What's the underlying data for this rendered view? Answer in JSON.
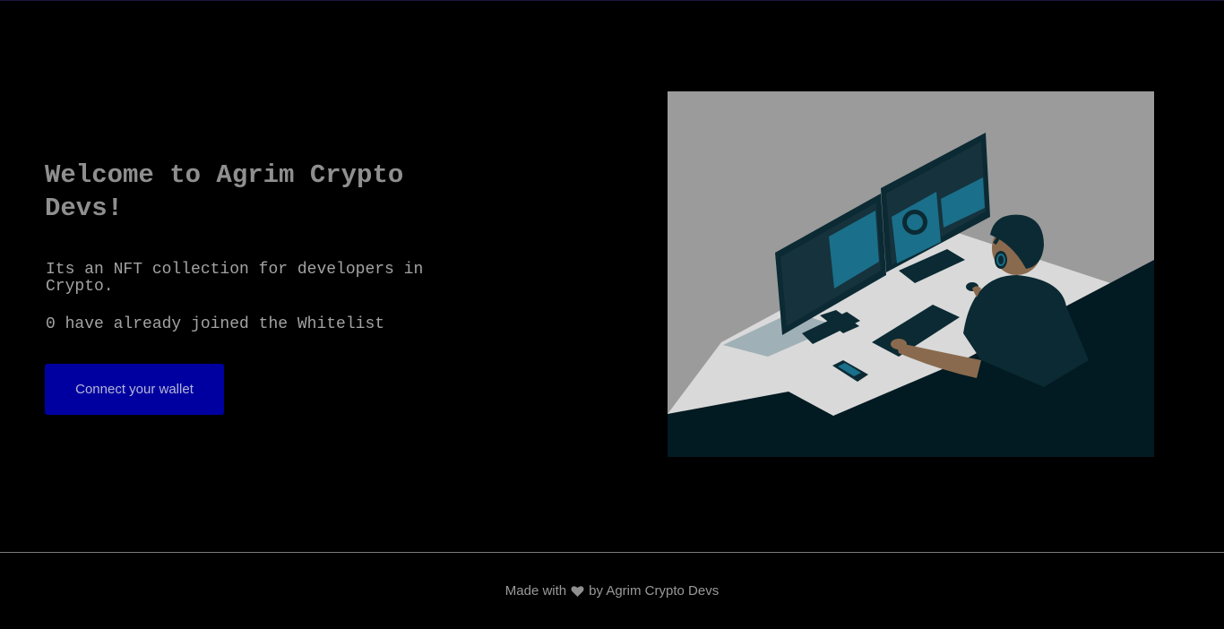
{
  "hero": {
    "title": "Welcome to Agrim Crypto Devs!",
    "description": "Its an NFT collection for developers in Crypto.",
    "joined_text": "0 have already joined the Whitelist",
    "connect_button_label": "Connect your wallet"
  },
  "illustration": {
    "icon": "developer-at-monitors-illustration"
  },
  "footer": {
    "text_before": "Made with",
    "icon": "heart-icon",
    "text_after": "by Agrim Crypto Devs"
  },
  "colors": {
    "background": "#000000",
    "button": "#0000a0",
    "text": "#a3a3a3",
    "illustration_bg": "#9b9b9b",
    "illustration_dark": "#021a22",
    "illustration_accent": "#1a6f8a"
  }
}
